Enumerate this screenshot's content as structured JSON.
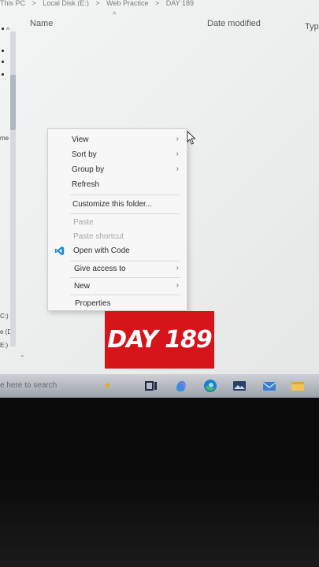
{
  "explorer": {
    "breadcrumb": [
      "This PC",
      ">",
      "Local Disk (E:)",
      ">",
      "Web Practice",
      ">",
      "DAY 189"
    ],
    "columns": {
      "name": "Name",
      "date_modified": "Date modified",
      "type": "Type"
    },
    "nav_pane": {
      "labels": [
        {
          "text": "me"
        },
        {
          "text": "C:)"
        },
        {
          "text": "e (D:"
        },
        {
          "text": "E:)"
        }
      ]
    }
  },
  "context_menu": {
    "items": [
      {
        "label": "View",
        "has_submenu": true,
        "disabled": false
      },
      {
        "label": "Sort by",
        "has_submenu": true,
        "disabled": false
      },
      {
        "label": "Group by",
        "has_submenu": true,
        "disabled": false
      },
      {
        "label": "Refresh",
        "has_submenu": false,
        "disabled": false
      },
      {
        "label": "Customize this folder...",
        "has_submenu": false,
        "disabled": false
      },
      {
        "label": "Paste",
        "has_submenu": false,
        "disabled": true
      },
      {
        "label": "Paste shortcut",
        "has_submenu": false,
        "disabled": true
      },
      {
        "label": "Open with Code",
        "has_submenu": false,
        "disabled": false,
        "icon": "vscode-icon"
      },
      {
        "label": "Give access to",
        "has_submenu": true,
        "disabled": false
      },
      {
        "label": "New",
        "has_submenu": true,
        "disabled": false
      },
      {
        "label": "Properties",
        "has_submenu": false,
        "disabled": false
      }
    ],
    "submenu_arrow": "›"
  },
  "overlay": {
    "banner_text": "DAY 189",
    "banner_color": "#d7141a"
  },
  "taskbar": {
    "search_placeholder": "e here to search",
    "icons": [
      "task-view-icon",
      "copilot-icon",
      "edge-icon",
      "photos-icon",
      "mail-icon",
      "file-explorer-icon"
    ]
  }
}
